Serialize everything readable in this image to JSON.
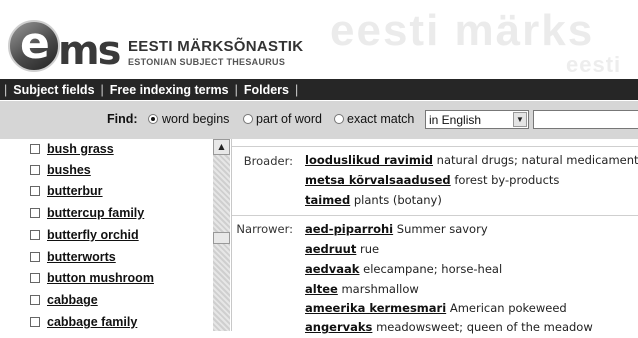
{
  "brand": {
    "logo_letters": "ems",
    "title": "EESTI MÄRKSÕNASTIK",
    "subtitle": "ESTONIAN SUBJECT THESAURUS",
    "watermark_main": "eesti märks",
    "watermark_sub": "eesti"
  },
  "nav": {
    "items": [
      {
        "label": "Subject fields"
      },
      {
        "label": "Free indexing terms"
      },
      {
        "label": "Folders"
      }
    ],
    "separator": "|"
  },
  "find": {
    "label": "Find:",
    "options": [
      {
        "label": "word begins",
        "selected": true
      },
      {
        "label": "part of word",
        "selected": false
      },
      {
        "label": "exact match",
        "selected": false
      }
    ],
    "language_select": "in English",
    "query": ""
  },
  "term_list": [
    {
      "label": "bush grass"
    },
    {
      "label": "bushes"
    },
    {
      "label": "butterbur"
    },
    {
      "label": "buttercup family"
    },
    {
      "label": "butterfly orchid"
    },
    {
      "label": "butterworts"
    },
    {
      "label": "button mushroom"
    },
    {
      "label": "cabbage"
    },
    {
      "label": "cabbage family"
    }
  ],
  "relations": {
    "broader": {
      "label": "Broader:",
      "items": [
        {
          "term": "looduslikud ravimid",
          "translation": "natural drugs; natural medicaments"
        },
        {
          "term": "metsa kõrvalsaadused",
          "translation": "forest by-products"
        },
        {
          "term": "taimed",
          "translation": "plants (botany)"
        }
      ]
    },
    "narrower": {
      "label": "Narrower:",
      "items": [
        {
          "term": "aed-piparrohi",
          "translation": "Summer savory"
        },
        {
          "term": "aedruut",
          "translation": "rue"
        },
        {
          "term": "aedvaak",
          "translation": "elecampane; horse-heal"
        },
        {
          "term": "altee",
          "translation": "marshmallow"
        },
        {
          "term": "ameerika kermesmari",
          "translation": "American pokeweed"
        },
        {
          "term": "angervaks",
          "translation": "meadowsweet; queen of the meadow"
        }
      ]
    }
  },
  "colors": {
    "navbar": "#262626",
    "findbar": "#d6d6d6",
    "link": "#111111"
  }
}
